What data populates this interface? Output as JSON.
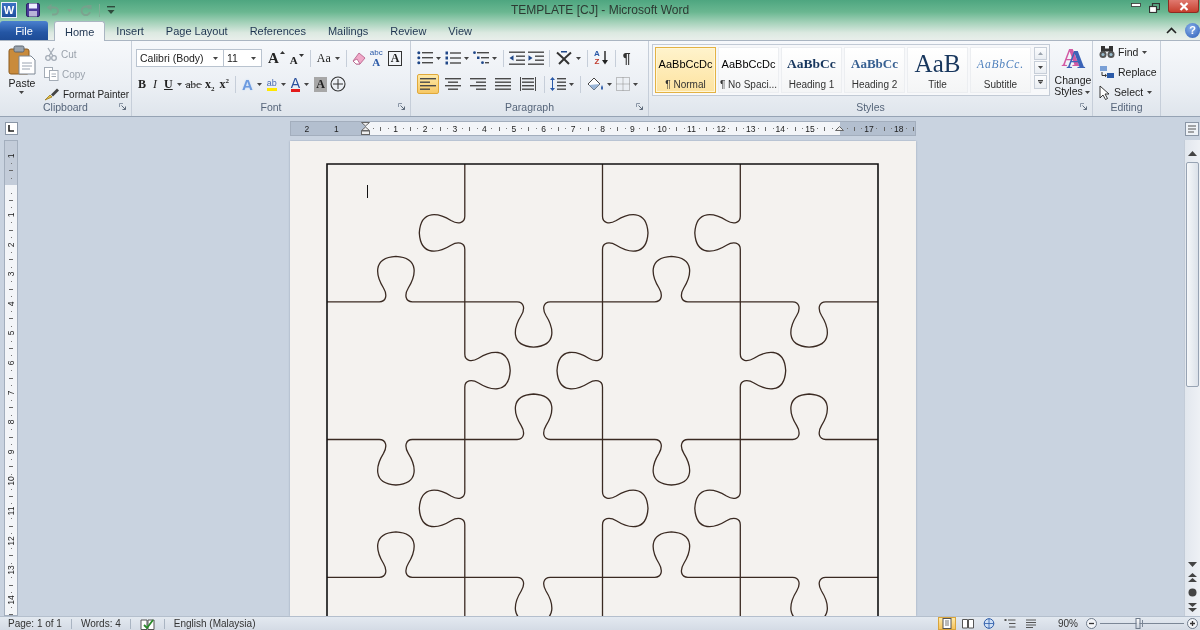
{
  "title_bar": {
    "app_icon": "W",
    "quick_access": [
      {
        "kind": "save",
        "disabled": false
      },
      {
        "kind": "undo",
        "disabled": true
      },
      {
        "kind": "redo",
        "disabled": true
      },
      {
        "kind": "customize",
        "disabled": false
      }
    ],
    "title": "TEMPLATE [CJ] - Microsoft Word"
  },
  "tabs": [
    {
      "label": "File",
      "kind": "backstage",
      "selected": false
    },
    {
      "label": "Home",
      "kind": "tab",
      "selected": true
    },
    {
      "label": "Insert",
      "kind": "tab",
      "selected": false
    },
    {
      "label": "Page Layout",
      "kind": "tab",
      "selected": false
    },
    {
      "label": "References",
      "kind": "tab",
      "selected": false
    },
    {
      "label": "Mailings",
      "kind": "tab",
      "selected": false
    },
    {
      "label": "Review",
      "kind": "tab",
      "selected": false
    },
    {
      "label": "View",
      "kind": "tab",
      "selected": false
    }
  ],
  "help": "?",
  "ribbon": {
    "clipboard": {
      "label": "Clipboard",
      "paste": "Paste",
      "commands": [
        {
          "kind": "cut",
          "label": "Cut",
          "disabled": true
        },
        {
          "kind": "copy",
          "label": "Copy",
          "disabled": true
        },
        {
          "kind": "format-painter",
          "label": "Format Painter",
          "disabled": false
        }
      ]
    },
    "font": {
      "label": "Font",
      "font_name": "Calibri (Body)",
      "font_size": "11",
      "row_1": [
        {
          "kind": "grow",
          "label": "A"
        },
        {
          "kind": "shrink",
          "label": "A"
        },
        {
          "kind": "separator"
        },
        {
          "kind": "case",
          "label": "Aa"
        },
        {
          "kind": "separator"
        },
        {
          "kind": "clear"
        },
        {
          "kind": "phonetic",
          "label": "A",
          "note": "abc"
        },
        {
          "kind": "border",
          "label": "A"
        }
      ],
      "row_2": [
        {
          "kind": "bold",
          "label": "B"
        },
        {
          "kind": "italic",
          "label": "I"
        },
        {
          "kind": "underline",
          "label": "U"
        },
        {
          "kind": "strike",
          "label": "abc"
        },
        {
          "kind": "subscript",
          "label": "x$_{2}$"
        },
        {
          "kind": "superscript",
          "label": "x$^{2}$"
        },
        {
          "kind": "separator"
        },
        {
          "kind": "effects",
          "label": "A"
        },
        {
          "kind": "highlight",
          "label": "ab"
        },
        {
          "kind": "color",
          "label": "A"
        },
        {
          "kind": "shading",
          "label": "A"
        },
        {
          "kind": "enclose"
        }
      ]
    },
    "paragraph": {
      "label": "Paragraph",
      "row_1": [
        {
          "kind": "bullets"
        },
        {
          "kind": "numbering"
        },
        {
          "kind": "multilevel"
        },
        {
          "kind": "separator"
        },
        {
          "kind": "outdent"
        },
        {
          "kind": "indent"
        },
        {
          "kind": "separator"
        },
        {
          "kind": "asian"
        },
        {
          "kind": "separator"
        },
        {
          "kind": "sort",
          "label": "A",
          "note": "Z"
        },
        {
          "kind": "separator"
        },
        {
          "kind": "pilcrow",
          "label": "¶"
        }
      ],
      "alignment": [
        {
          "kind": "left",
          "selected": true
        },
        {
          "kind": "center",
          "selected": false
        },
        {
          "kind": "right",
          "selected": false
        },
        {
          "kind": "justify",
          "selected": false
        },
        {
          "kind": "distribute",
          "selected": false
        }
      ],
      "row_2": [
        {
          "kind": "separator"
        },
        {
          "kind": "line-spacing"
        },
        {
          "kind": "separator"
        },
        {
          "kind": "shading"
        },
        {
          "kind": "borders"
        }
      ]
    },
    "styles": {
      "label": "Styles",
      "gallery": [
        {
          "kind": "normal",
          "preview": "AaBbCcDc",
          "label": "¶ Normal",
          "selected": true
        },
        {
          "kind": "normal",
          "preview": "AaBbCcDc",
          "label": "¶ No Spaci...",
          "selected": false
        },
        {
          "kind": "heading1",
          "preview": "AaBbCc",
          "label": "Heading 1",
          "selected": false
        },
        {
          "kind": "heading2",
          "preview": "AaBbCc",
          "label": "Heading 2",
          "selected": false
        },
        {
          "kind": "title",
          "preview": "AaB",
          "label": "Title",
          "selected": false
        },
        {
          "kind": "subtitle",
          "preview": "AaBbCc.",
          "label": "Subtitle",
          "selected": false
        }
      ],
      "change_styles": {
        "label": "Change Styles",
        "glyph": "A"
      }
    },
    "editing": {
      "label": "Editing",
      "commands": [
        {
          "kind": "find",
          "label": "Find"
        },
        {
          "kind": "replace",
          "label": "Replace"
        },
        {
          "kind": "select",
          "label": "Select"
        }
      ]
    }
  },
  "ruler": {
    "marks": [
      {
        "kind": "number",
        "label": "2"
      },
      {
        "kind": "number",
        "label": "1"
      },
      {
        "kind": "indent"
      },
      {
        "kind": "number",
        "label": "1"
      },
      {
        "kind": "number",
        "label": "2"
      },
      {
        "kind": "number",
        "label": "3"
      },
      {
        "kind": "number",
        "label": "4"
      },
      {
        "kind": "number",
        "label": "5"
      },
      {
        "kind": "number",
        "label": "6"
      },
      {
        "kind": "number",
        "label": "7"
      },
      {
        "kind": "number",
        "label": "8"
      },
      {
        "kind": "number",
        "label": "9"
      },
      {
        "kind": "number",
        "label": "10"
      },
      {
        "kind": "number",
        "label": "11"
      },
      {
        "kind": "number",
        "label": "12"
      },
      {
        "kind": "number",
        "label": "13"
      },
      {
        "kind": "number",
        "label": "14"
      },
      {
        "kind": "number",
        "label": "15"
      },
      {
        "kind": "right-indent"
      },
      {
        "kind": "number",
        "label": "17"
      },
      {
        "kind": "number",
        "label": "18"
      }
    ]
  },
  "vertical_ruler": {
    "marks": [
      {
        "kind": "number",
        "label": "1"
      },
      {
        "kind": "margin"
      },
      {
        "kind": "number",
        "label": "1"
      },
      {
        "kind": "number",
        "label": "2"
      },
      {
        "kind": "number",
        "label": "3"
      },
      {
        "kind": "number",
        "label": "4"
      },
      {
        "kind": "number",
        "label": "5"
      },
      {
        "kind": "number",
        "label": "6"
      },
      {
        "kind": "number",
        "label": "7"
      },
      {
        "kind": "number",
        "label": "8"
      },
      {
        "kind": "number",
        "label": "9"
      },
      {
        "kind": "number",
        "label": "10"
      },
      {
        "kind": "number",
        "label": "11"
      },
      {
        "kind": "number",
        "label": "12"
      },
      {
        "kind": "number",
        "label": "13"
      },
      {
        "kind": "number",
        "label": "14"
      }
    ]
  },
  "status_bar": {
    "page": "Page: 1 of 1",
    "words": "Words: 4",
    "language": "English (Malaysia)",
    "views": [
      {
        "kind": "print-layout",
        "selected": true
      },
      {
        "kind": "full-screen-reading",
        "selected": false
      },
      {
        "kind": "web-layout",
        "selected": false
      },
      {
        "kind": "outline",
        "selected": false
      },
      {
        "kind": "draft",
        "selected": false
      }
    ],
    "zoom": "90%",
    "zoom_slider": {
      "level": 0.45
    }
  }
}
